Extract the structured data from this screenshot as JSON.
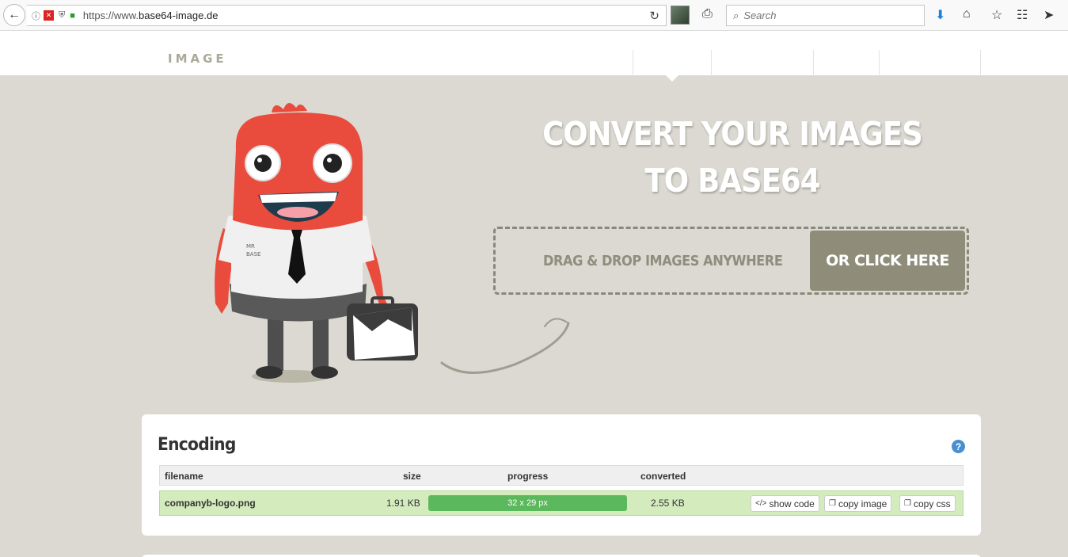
{
  "browser": {
    "url_prefix": "https://www.",
    "url_host": "base64-image.de",
    "search_placeholder": "Search",
    "icons": [
      "back-icon",
      "info-icon",
      "blocked-icon",
      "shield-icon",
      "lock-icon",
      "reload-icon",
      "print-icon",
      "search-icon",
      "download-icon",
      "home-icon",
      "bookmark-star-icon",
      "reader-icon",
      "send-icon"
    ]
  },
  "site": {
    "logo_word": "IMAGE"
  },
  "hero": {
    "title_line1": "CONVERT YOUR IMAGES",
    "title_line2": "TO BASE64",
    "dropzone_text": "DRAG & DROP IMAGES ANYWHERE",
    "click_button": "OR CLICK HERE",
    "mascot_shirt_line1": "MR",
    "mascot_shirt_line2": "BASE"
  },
  "encoding": {
    "title": "Encoding",
    "help": "?",
    "columns": {
      "filename": "filename",
      "size": "size",
      "progress": "progress",
      "converted": "converted"
    },
    "rows": [
      {
        "filename": "companyb-logo.png",
        "size": "1.91 KB",
        "progress_label": "32 x 29 px",
        "progress_fraction": 1.0,
        "converted": "2.55 KB",
        "show_code": "show code",
        "copy_image": "copy image",
        "copy_css": "copy css"
      }
    ]
  },
  "colors": {
    "page_bg": "#dbd9d1",
    "accent_button": "#8f8d7a",
    "progress_green": "#5cb85c",
    "row_green": "#d4ecbd",
    "mascot_red": "#e94b3c"
  }
}
